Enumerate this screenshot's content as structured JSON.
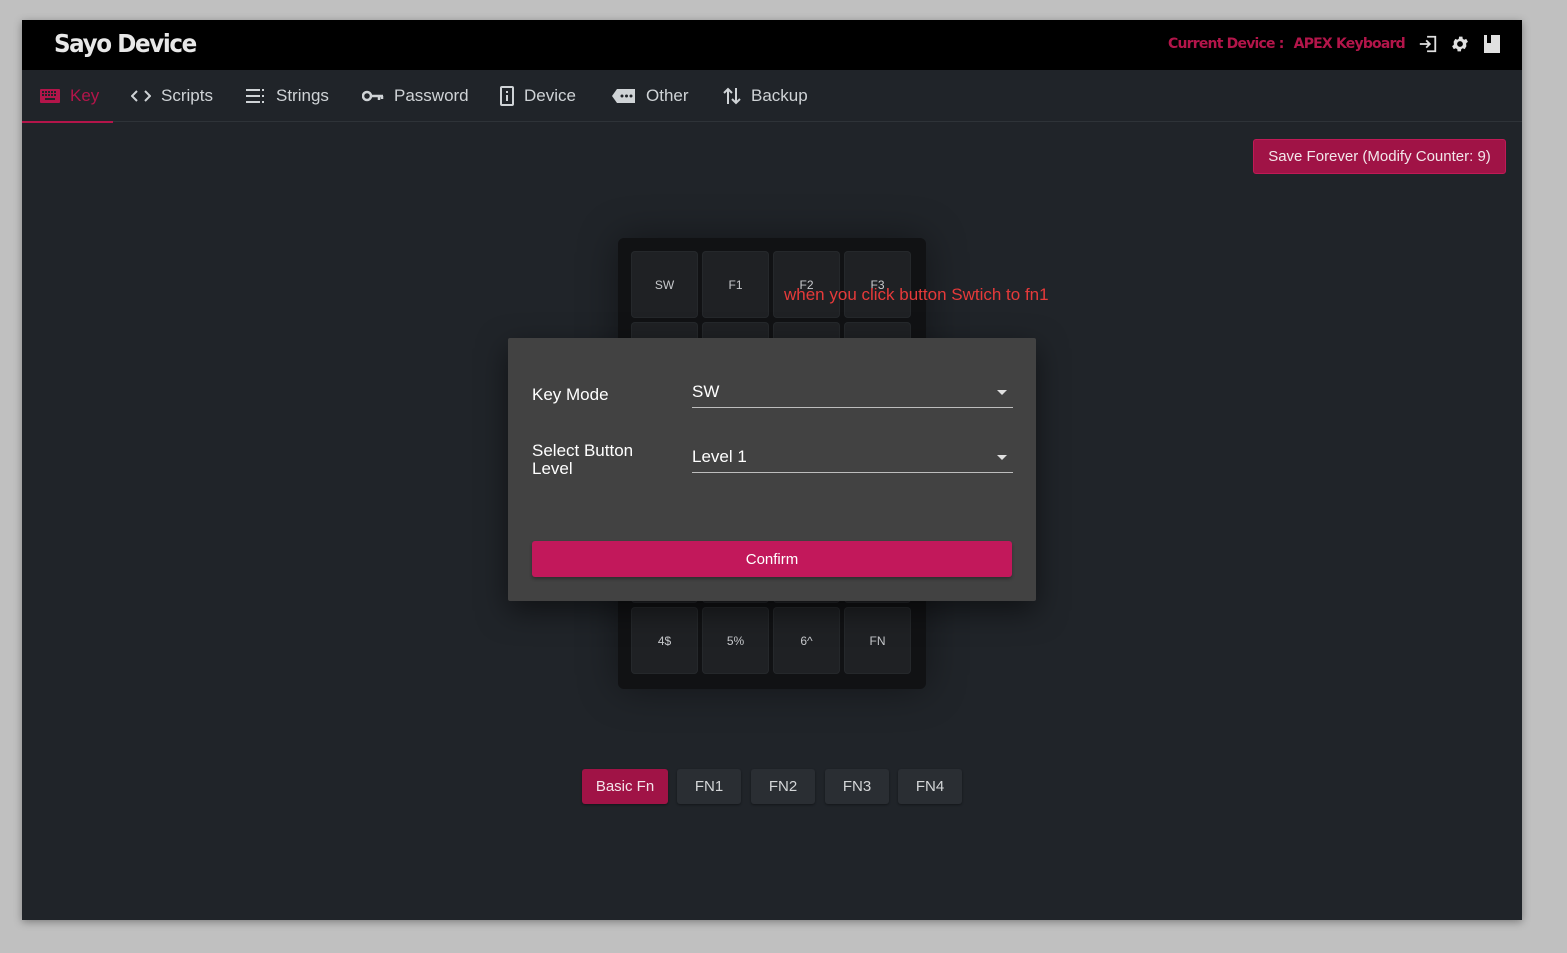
{
  "header": {
    "brand": "Sayo Device",
    "device_label": "Current Device :",
    "device_name": "APEX Keyboard",
    "icons": [
      "login-icon",
      "gear-icon",
      "book-icon"
    ]
  },
  "tabs": [
    {
      "label": "Key",
      "icon": "keyboard-icon",
      "active": true
    },
    {
      "label": "Scripts",
      "icon": "code-icon",
      "active": false
    },
    {
      "label": "Strings",
      "icon": "list-icon",
      "active": false
    },
    {
      "label": "Password",
      "icon": "key-icon",
      "active": false
    },
    {
      "label": "Device",
      "icon": "device-icon",
      "active": false
    },
    {
      "label": "Other",
      "icon": "dots-icon",
      "active": false
    },
    {
      "label": "Backup",
      "icon": "swap-icon",
      "active": false
    }
  ],
  "save_button": "Save Forever (Modify Counter: 9)",
  "keys": {
    "row1": [
      "SW",
      "F1",
      "F2",
      "F3"
    ],
    "last_row": [
      "4$",
      "5%",
      "6^",
      "FN"
    ]
  },
  "annotation": "when you click button Swtich to fn1",
  "dialog": {
    "key_mode_label": "Key Mode",
    "key_mode_value": "SW",
    "level_label_line1": "Select Button",
    "level_label_line2": "Level",
    "level_value": "Level 1",
    "confirm": "Confirm"
  },
  "fn_tabs": [
    {
      "label": "Basic Fn",
      "active": true
    },
    {
      "label": "FN1",
      "active": false
    },
    {
      "label": "FN2",
      "active": false
    },
    {
      "label": "FN3",
      "active": false
    },
    {
      "label": "FN4",
      "active": false
    }
  ],
  "colors": {
    "accent": "#c2185b",
    "accent_dark": "#a01346",
    "header_text_accent": "#b3154a",
    "background": "#202429",
    "dialog": "#424242"
  }
}
